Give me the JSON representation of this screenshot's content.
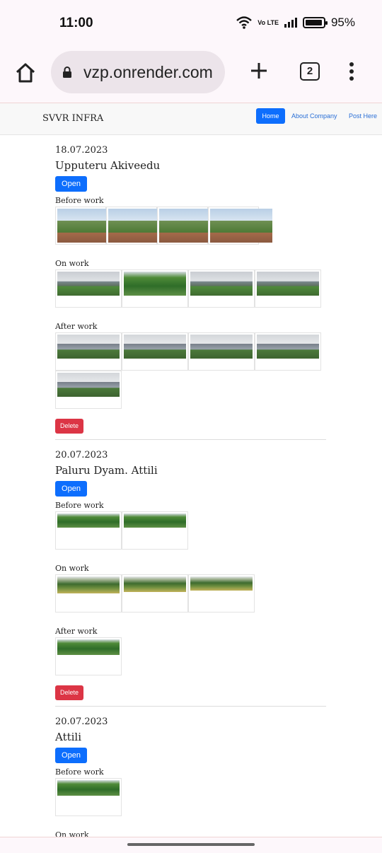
{
  "status_bar": {
    "time": "11:00",
    "network": "Vo LTE",
    "battery": "95%"
  },
  "browser": {
    "url": "vzp.onrender.com",
    "tab_count": "2"
  },
  "navbar": {
    "brand": "SVVR INFRA",
    "links": [
      "Home",
      "About Company",
      "Post Here"
    ]
  },
  "labels": {
    "open": "Open",
    "delete": "Delete",
    "before": "Before work",
    "on": "On work",
    "after": "After work"
  },
  "posts": [
    {
      "date": "18.07.2023",
      "title": "Upputeru Akiveedu"
    },
    {
      "date": "20.07.2023",
      "title": "Paluru Dyam. Attili"
    },
    {
      "date": "20.07.2023",
      "title": "Attili"
    }
  ]
}
